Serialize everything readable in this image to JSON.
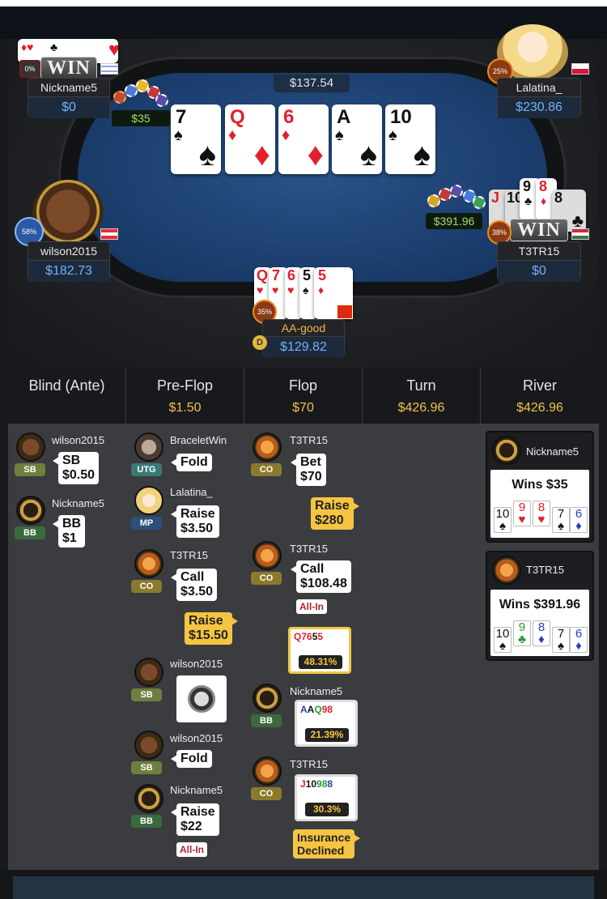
{
  "table": {
    "pot": "$137.54",
    "board": [
      {
        "rank": "7",
        "suit": "♠",
        "color": "blk"
      },
      {
        "rank": "Q",
        "suit": "♦",
        "color": "red"
      },
      {
        "rank": "6",
        "suit": "♦",
        "color": "red"
      },
      {
        "rank": "A",
        "suit": "♠",
        "color": "blk"
      },
      {
        "rank": "10",
        "suit": "♠",
        "color": "blk"
      }
    ],
    "players": {
      "nickname5": {
        "name": "Nickname5",
        "stack": "$0",
        "badge": "0%",
        "win": "WIN",
        "bet": "$35"
      },
      "lalatina": {
        "name": "Lalatina_",
        "stack": "$230.86",
        "badge": "25%"
      },
      "wilson": {
        "name": "wilson2015",
        "stack": "$182.73",
        "badge": "58%"
      },
      "t3tr15": {
        "name": "T3TR15",
        "stack": "$0",
        "badge": "38%",
        "win": "WIN",
        "bet": "$391.96"
      },
      "aagood": {
        "name": "AA-good",
        "stack": "$129.82",
        "badge": "35%",
        "dealer": "D"
      }
    }
  },
  "history": {
    "columns": [
      {
        "title": "Blind (Ante)",
        "amount": ""
      },
      {
        "title": "Pre-Flop",
        "amount": "$1.50"
      },
      {
        "title": "Flop",
        "amount": "$70"
      },
      {
        "title": "Turn",
        "amount": "$426.96"
      },
      {
        "title": "River",
        "amount": "$426.96"
      }
    ],
    "blind": [
      {
        "name": "wilson2015",
        "pos": "SB",
        "action": [
          "SB",
          "$0.50"
        ]
      },
      {
        "name": "Nickname5",
        "pos": "BB",
        "action": [
          "BB",
          "$1"
        ]
      }
    ],
    "preflop": [
      {
        "name": "BraceletWin",
        "pos": "UTG",
        "action": [
          "Fold"
        ]
      },
      {
        "name": "Lalatina_",
        "pos": "MP",
        "action": [
          "Raise",
          "$3.50"
        ]
      },
      {
        "name": "T3TR15",
        "pos": "CO",
        "action": [
          "Call",
          "$3.50"
        ]
      },
      {
        "raise": [
          "Raise",
          "$15.50"
        ]
      },
      {
        "name": "wilson2015",
        "pos": "SB"
      },
      {
        "name": "wilson2015",
        "pos": "SB",
        "action": [
          "Fold"
        ]
      },
      {
        "name": "Nickname5",
        "pos": "BB",
        "action": [
          "Raise",
          "$22"
        ],
        "allin": "All-In"
      }
    ],
    "flop": [
      {
        "name": "T3TR15",
        "pos": "CO",
        "action": [
          "Bet",
          "$70"
        ]
      },
      {
        "raise": [
          "Raise",
          "$280"
        ]
      },
      {
        "name": "T3TR15",
        "pos": "CO",
        "action": [
          "Call",
          "$108.48"
        ],
        "allin": "All-In"
      },
      {
        "equity": "48.31%"
      },
      {
        "name": "Nickname5",
        "pos": "BB",
        "equity": "21.39%"
      },
      {
        "name": "T3TR15",
        "pos": "CO",
        "equity": "30.3%"
      },
      {
        "insurance": [
          "Insurance",
          "Declined"
        ]
      }
    ],
    "river": [
      {
        "name": "Nickname5",
        "wins": "Wins $35"
      },
      {
        "name": "T3TR15",
        "wins": "Wins $391.96"
      }
    ]
  }
}
